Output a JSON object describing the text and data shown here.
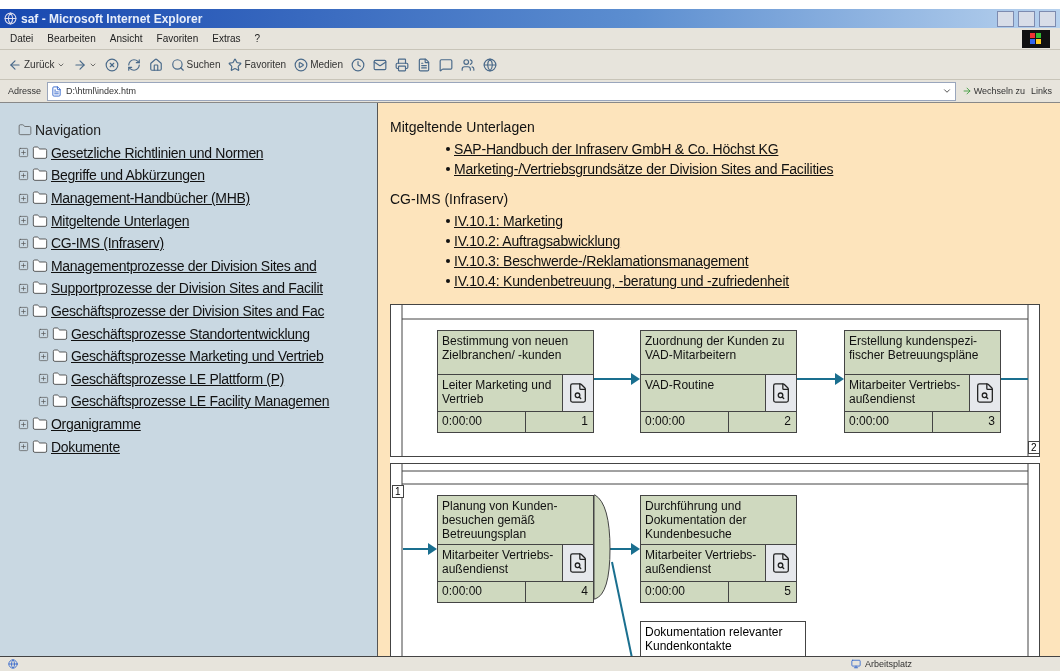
{
  "window": {
    "title": "saf - Microsoft Internet Explorer"
  },
  "menu": [
    "Datei",
    "Bearbeiten",
    "Ansicht",
    "Favoriten",
    "Extras",
    "?"
  ],
  "toolbar": [
    {
      "kind": "back",
      "label": "Zurück"
    },
    {
      "kind": "forward"
    },
    {
      "kind": "stop"
    },
    {
      "kind": "refresh"
    },
    {
      "kind": "home"
    },
    {
      "kind": "search",
      "label": "Suchen"
    },
    {
      "kind": "favorites",
      "label": "Favoriten"
    },
    {
      "kind": "media",
      "label": "Medien"
    },
    {
      "kind": "history"
    },
    {
      "kind": "mail"
    },
    {
      "kind": "print"
    },
    {
      "kind": "edit"
    },
    {
      "kind": "discuss"
    },
    {
      "kind": "messenger"
    },
    {
      "kind": "globe"
    }
  ],
  "address": {
    "label": "Adresse",
    "value": "D:\\html\\index.htm",
    "go": "Wechseln zu",
    "links": "Links"
  },
  "navigation": {
    "title": "Navigation",
    "items": [
      {
        "label": "Gesetzliche Richtlinien und Normen"
      },
      {
        "label": "Begriffe und Abkürzungen"
      },
      {
        "label": "Management-Handbücher (MHB)"
      },
      {
        "label": "Mitgeltende Unterlagen"
      },
      {
        "label": "CG-IMS (Infraserv)"
      },
      {
        "label": "Managementprozesse der Division Sites and"
      },
      {
        "label": "Supportprozesse der Division Sites and Facilit"
      },
      {
        "label": "Geschäftsprozesse der Division Sites and Fac",
        "children": [
          {
            "label": "Geschäftsprozesse Standortentwicklung"
          },
          {
            "label": "Geschäftsprozesse Marketing und Vertrieb"
          },
          {
            "label": "Geschäftsprozesse LE Plattform (P)"
          },
          {
            "label": "Geschäftsprozesse LE Facility Managemen"
          }
        ]
      },
      {
        "label": "Organigramme"
      },
      {
        "label": "Dokumente"
      }
    ]
  },
  "sections": [
    {
      "heading": "Mitgeltende Unterlagen",
      "links": [
        "SAP-Handbuch der Infraserv GmbH & Co. Höchst KG",
        "Marketing-/Vertriebsgrundsätze der Division Sites and Facilities"
      ]
    },
    {
      "heading": "CG-IMS (Infraserv)",
      "links": [
        "IV.10.1: Marketing",
        "IV.10.2: Auftragsabwicklung",
        "IV.10.3: Beschwerde-/Reklamationsmanagement",
        "IV.10.4: Kundenbetreuung, -beratung und -zufriedenheit"
      ]
    }
  ],
  "diagram": {
    "pages": [
      {
        "marker": "2",
        "processes": [
          {
            "title": "Bestimmung von neuen Zielbranchen/ -kunden",
            "role": "Leiter Marketing und Vertrieb",
            "time": "0:00:00",
            "number": "1"
          },
          {
            "title": "Zuordnung der Kunden zu VAD-Mitarbeitern",
            "role": "VAD-Routine",
            "time": "0:00:00",
            "number": "2"
          },
          {
            "title": "Erstellung kundenspezi-fischer Betreuungspläne",
            "role": "Mitarbeiter Vertriebs-außendienst",
            "time": "0:00:00",
            "number": "3"
          }
        ]
      },
      {
        "marker": "1",
        "processes": [
          {
            "title": "Planung von Kunden-besuchen gemäß Betreuungsplan",
            "role": "Mitarbeiter Vertriebs-außendienst",
            "time": "0:00:00",
            "number": "4"
          },
          {
            "title": "Durchführung und Dokumentation der Kundenbesuche",
            "role": "Mitarbeiter Vertriebs-außendienst",
            "time": "0:00:00",
            "number": "5"
          }
        ],
        "document": "Dokumentation relevanter Kundenkontakte"
      }
    ]
  },
  "status_bar": {
    "zone": "Arbeitsplatz"
  }
}
